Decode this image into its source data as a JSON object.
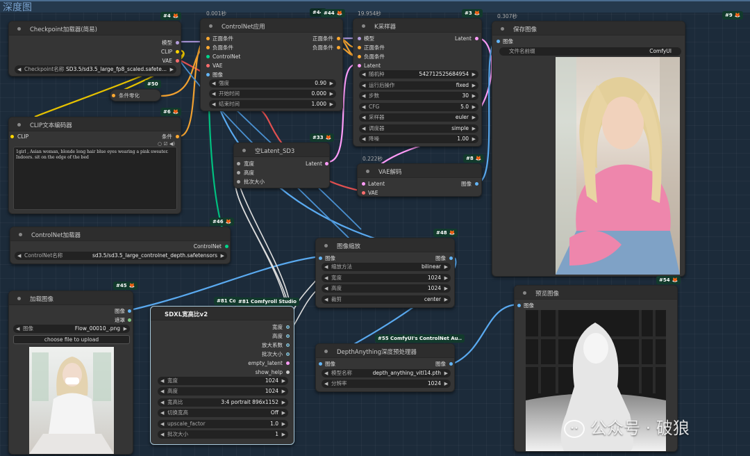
{
  "group": {
    "title": "深度图"
  },
  "nodes": {
    "checkpoint": {
      "title": "Checkpoint加载器(简易)",
      "id": "#4",
      "out": [
        "模型",
        "CLIP",
        "VAE"
      ],
      "w_label": "Checkpoint名称",
      "w_value": "SD3.5/sd3.5_large_fp8_scaled.safete..."
    },
    "cond_zero": {
      "title": "条件零化",
      "id": "#50"
    },
    "clip_text": {
      "title": "CLIP文本编码器",
      "id": "#6",
      "in": "CLIP",
      "out": "条件",
      "text": "1girl , Asian woman, blonde long hair blue eyes wearing a pink sweater. Indoors. sit on the edge of the bed"
    },
    "controlnet_apply": {
      "title": "ControlNet应用",
      "id": "#44",
      "time": "0.001秒",
      "in": [
        "正面条件",
        "负面条件",
        "ControlNet",
        "VAE",
        "图像"
      ],
      "out": [
        "正面条件",
        "负面条件"
      ],
      "widgets": [
        {
          "l": "强度",
          "v": "0.90"
        },
        {
          "l": "开始时间",
          "v": "0.000"
        },
        {
          "l": "结束时间",
          "v": "1.000"
        }
      ]
    },
    "ksampler": {
      "title": "K采样器",
      "id": "#3",
      "time": "19.954秒",
      "in": [
        "模型",
        "正面条件",
        "负面条件",
        "Latent"
      ],
      "out": "Latent",
      "widgets": [
        {
          "l": "随机种",
          "v": "542712525684954"
        },
        {
          "l": "运行后操作",
          "v": "fixed"
        },
        {
          "l": "步数",
          "v": "30"
        },
        {
          "l": "CFG",
          "v": "5.0"
        },
        {
          "l": "采样器",
          "v": "euler"
        },
        {
          "l": "调度器",
          "v": "simple"
        },
        {
          "l": "降噪",
          "v": "1.00"
        }
      ]
    },
    "save_image": {
      "title": "保存图像",
      "id": "#9",
      "time": "0.307秒",
      "in": "图像",
      "w_label": "文件名前缀",
      "w_value": "ComfyUI"
    },
    "latent_sd3": {
      "title": "空Latent_SD3",
      "id": "#33",
      "in": [
        "宽度",
        "高度",
        "批次大小"
      ],
      "out": "Latent"
    },
    "vae_decode": {
      "title": "VAE解码",
      "id": "#8",
      "time": "0.222秒",
      "in": [
        "Latent",
        "VAE"
      ],
      "out": "图像"
    },
    "controlnet_loader": {
      "title": "ControlNet加载器",
      "id": "#46",
      "out": "ControlNet",
      "w_label": "ControlNet名称",
      "w_value": "sd3.5/sd3.5_large_controlnet_depth.safetensors"
    },
    "image_scale": {
      "title": "图像缩放",
      "id": "#48",
      "in": "图像",
      "out": "图像",
      "widgets": [
        {
          "l": "缩放方法",
          "v": "bilinear"
        },
        {
          "l": "宽度",
          "v": "1024"
        },
        {
          "l": "高度",
          "v": "1024"
        },
        {
          "l": "裁剪",
          "v": "center"
        }
      ]
    },
    "load_image": {
      "title": "加载图像",
      "id": "#45",
      "out": [
        "图像",
        "遮罩"
      ],
      "w_label": "图像",
      "w_value": "Flow_00010_.png",
      "upload": "choose file to upload"
    },
    "sdxl_ratio": {
      "title": "SDXL宽高比v2",
      "id": "#81 Cor",
      "id2": "#81 Comfyroll Studio",
      "out": [
        "宽度",
        "高度",
        "放大系数",
        "批次大小",
        "empty_latent",
        "show_help"
      ],
      "widgets": [
        {
          "l": "宽度",
          "v": "1024"
        },
        {
          "l": "高度",
          "v": "1024"
        },
        {
          "l": "宽高比",
          "v": "3:4 portrait 896x1152"
        },
        {
          "l": "切换宽高",
          "v": "Off"
        },
        {
          "l": "upscale_factor",
          "v": "1.0"
        },
        {
          "l": "批次大小",
          "v": "1"
        }
      ]
    },
    "depth_anything": {
      "title": "DepthAnything深度预处理器",
      "id": "#55 ComfyUI's ControlNet Au..",
      "in": "图像",
      "out": "图像",
      "widgets": [
        {
          "l": "模型名称",
          "v": "depth_anything_vitl14.pth"
        },
        {
          "l": "分辨率",
          "v": "1024"
        }
      ]
    },
    "preview": {
      "title": "预览图像",
      "id": "#54",
      "in": "图像"
    }
  },
  "watermark": "公众号 · 破狼",
  "colors": {
    "model": "#b39ddb",
    "clip": "#ffd500",
    "vae": "#ff6e6e",
    "cond": "#ffa931",
    "image": "#64b5f6",
    "latent": "#ff9cf9",
    "controlnet": "#00d78d",
    "int": "#aaaaaa",
    "mask": "#81c784"
  }
}
